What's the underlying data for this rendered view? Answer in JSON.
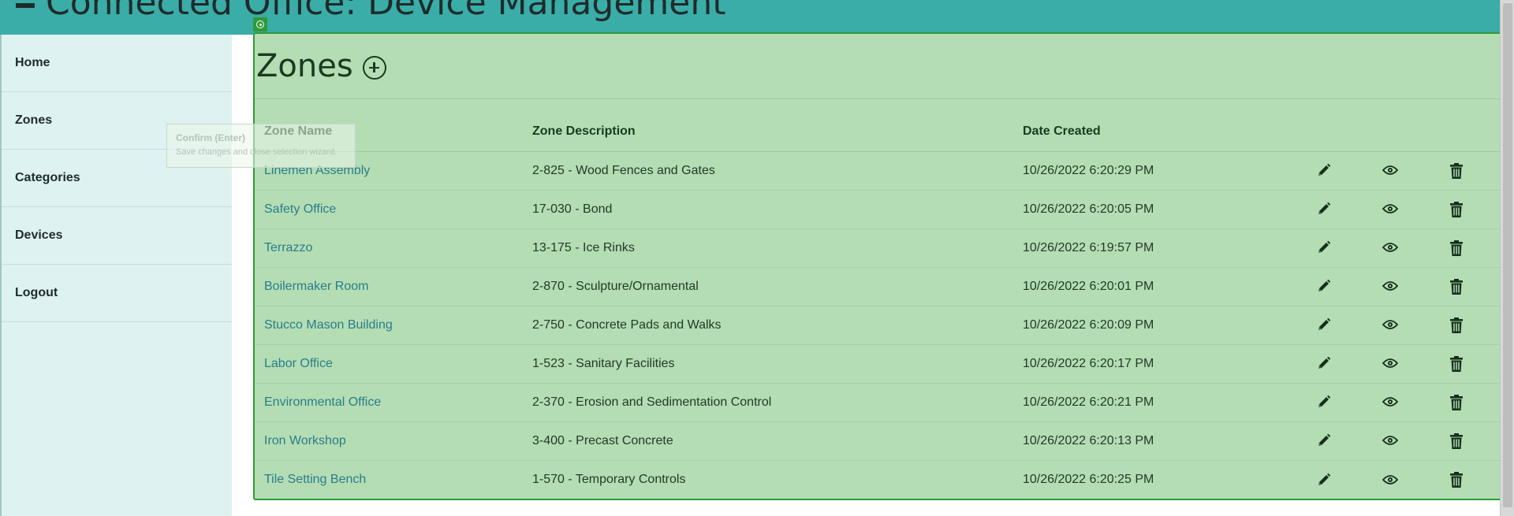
{
  "header": {
    "title": "Connected Office: Device Management"
  },
  "sidebar": {
    "items": [
      {
        "label": "Home"
      },
      {
        "label": "Zones"
      },
      {
        "label": "Categories"
      },
      {
        "label": "Devices"
      },
      {
        "label": "Logout"
      }
    ]
  },
  "tooltip": {
    "title": "Confirm (Enter)",
    "text": "Save changes and close selection wizard."
  },
  "main": {
    "title": "Zones",
    "add_icon": "plus-circle-icon",
    "columns": [
      "Zone Name",
      "Zone Description",
      "Date Created"
    ],
    "rows": [
      {
        "name": "Linemen Assembly",
        "description": "2-825 - Wood Fences and Gates",
        "created": "10/26/2022 6:20:29 PM"
      },
      {
        "name": "Safety Office",
        "description": "17-030 - Bond",
        "created": "10/26/2022 6:20:05 PM"
      },
      {
        "name": "Terrazzo",
        "description": "13-175 - Ice Rinks",
        "created": "10/26/2022 6:19:57 PM"
      },
      {
        "name": "Boilermaker Room",
        "description": "2-870 - Sculpture/Ornamental",
        "created": "10/26/2022 6:20:01 PM"
      },
      {
        "name": "Stucco Mason Building",
        "description": "2-750 - Concrete Pads and Walks",
        "created": "10/26/2022 6:20:09 PM"
      },
      {
        "name": "Labor Office",
        "description": "1-523 - Sanitary Facilities",
        "created": "10/26/2022 6:20:17 PM"
      },
      {
        "name": "Environmental Office",
        "description": "2-370 - Erosion and Sedimentation Control",
        "created": "10/26/2022 6:20:21 PM"
      },
      {
        "name": "Iron Workshop",
        "description": "3-400 - Precast Concrete",
        "created": "10/26/2022 6:20:13 PM"
      },
      {
        "name": "Tile Setting Bench",
        "description": "1-570 - Temporary Controls",
        "created": "10/26/2022 6:20:25 PM"
      }
    ],
    "row_action_icons": [
      "pencil-icon",
      "eye-icon",
      "trash-icon"
    ]
  },
  "colors": {
    "header": "#3aada8",
    "sidebar": "#dff2f2",
    "panel": "#b4ddb4",
    "panel_border": "#2e9a3a",
    "link": "#2a7d8a"
  }
}
